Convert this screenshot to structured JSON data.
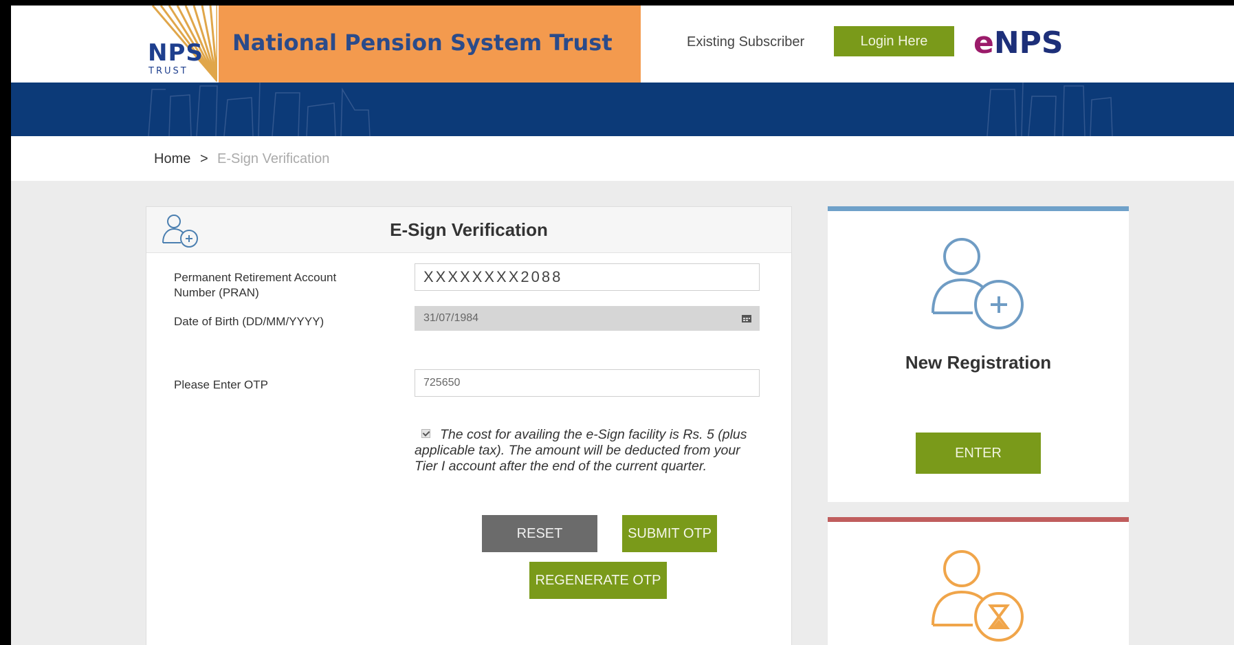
{
  "header": {
    "logo_letters": "NPS",
    "logo_sub": "TRUST",
    "brand_title": "National Pension System Trust",
    "existing_label": "Existing Subscriber",
    "login_button": "Login Here",
    "enps_e": "e",
    "enps_rest": "NPS"
  },
  "breadcrumb": {
    "home": "Home",
    "separator": ">",
    "current": "E-Sign Verification"
  },
  "form": {
    "title": "E-Sign Verification",
    "pran_label": "Permanent Retirement Account Number (PRAN)",
    "pran_value": "XXXXXXXX2088",
    "dob_label": "Date of Birth (DD/MM/YYYY)",
    "dob_value": "31/07/1984",
    "otp_label": "Please Enter OTP",
    "otp_value": "725650",
    "consent_checked": true,
    "consent_text": "The cost for availing the e-Sign facility is Rs. 5 (plus applicable tax). The amount will be deducted from your Tier I account after the end of the current quarter.",
    "reset_button": "RESET",
    "submit_button": "SUBMIT OTP",
    "regenerate_button": "REGENERATE OTP"
  },
  "side": {
    "registration_title": "New Registration",
    "enter_button": "ENTER",
    "registration_icon": "user-add-icon",
    "pending_icon": "user-hourglass-icon"
  },
  "colors": {
    "brand_orange": "#f39a4e",
    "nav_blue": "#0c3a78",
    "button_green": "#7a9a1a",
    "reset_gray": "#6b6b6b",
    "panel_blue": "#6fa1c9",
    "panel_red": "#c05d5d",
    "enps_magenta": "#9b1b6a",
    "enps_navy": "#1d2f79"
  }
}
